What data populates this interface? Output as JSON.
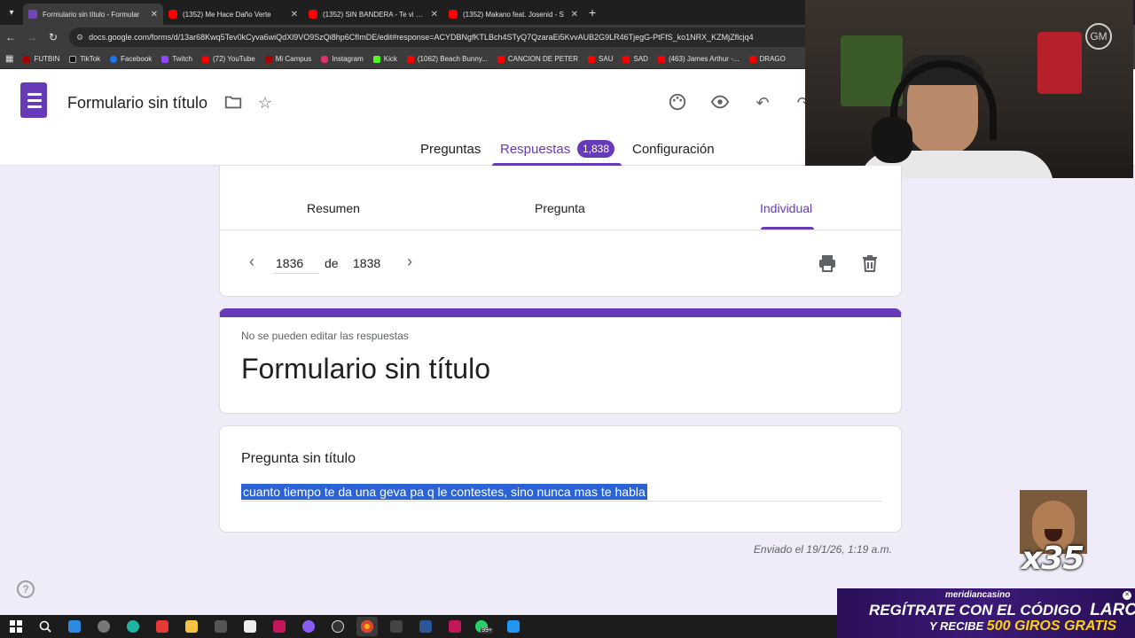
{
  "browser": {
    "tabs": [
      {
        "title": "Formulario sin título - Formular",
        "type": "forms",
        "active": true
      },
      {
        "title": "(1352) Me Hace Daño Verte",
        "type": "yt",
        "active": false
      },
      {
        "title": "(1352) SIN BANDERA - Te vi ven",
        "type": "yt",
        "active": false
      },
      {
        "title": "(1352) Makano feat. Josenid - S",
        "type": "yt",
        "active": false
      }
    ],
    "url": "docs.google.com/forms/d/13ar68Kwq5Tev0kCyva6wiQdXl9VO9SzQi8hp6CfImDE/edit#response=ACYDBNgfKTLBch4STyQ7QzaraEi5KvvAUB2G9LR46TjegG-PtFfS_ko1NRX_KZMjZflcjq4",
    "bookmarks": [
      {
        "label": "FUTBIN",
        "icon": "mc"
      },
      {
        "label": "TikTok",
        "icon": "tk"
      },
      {
        "label": "Facebook",
        "icon": "fb"
      },
      {
        "label": "Twitch",
        "icon": "tw"
      },
      {
        "label": "(72) YouTube",
        "icon": "yt"
      },
      {
        "label": "Mi Campus",
        "icon": "mc"
      },
      {
        "label": "Instagram",
        "icon": "ig"
      },
      {
        "label": "Kick",
        "icon": "kk"
      },
      {
        "label": "(1062) Beach Bunny...",
        "icon": "yt"
      },
      {
        "label": "CANCION DE PETER",
        "icon": "yt"
      },
      {
        "label": "SAU",
        "icon": "yt"
      },
      {
        "label": "SAD",
        "icon": "yt"
      },
      {
        "label": "(463) James Arthur -...",
        "icon": "yt"
      },
      {
        "label": "DRAGO",
        "icon": "yt"
      }
    ]
  },
  "header": {
    "form_title": "Formulario sin título",
    "tabs": {
      "questions": "Preguntas",
      "responses": "Respuestas",
      "responses_count": "1,838",
      "settings": "Configuración"
    }
  },
  "responses": {
    "subtabs": {
      "summary": "Resumen",
      "question": "Pregunta",
      "individual": "Individual"
    },
    "pager": {
      "current": "1836",
      "of_label": "de",
      "total": "1838"
    }
  },
  "form_card": {
    "no_edit_notice": "No se pueden editar las respuestas",
    "title": "Formulario sin título"
  },
  "question_card": {
    "question": "Pregunta sin título",
    "answer": "cuanto tiempo te da una geva pa q le contestes, sino nunca mas te habla"
  },
  "submitted": "Enviado el 19/1/26, 1:19 a.m.",
  "overlays": {
    "webcam_logo": "GM",
    "meme_count": "x35",
    "banner": {
      "brand": "meridiancasino",
      "line1": "REGÍTRATE CON EL CÓDIGO",
      "code": "LARCPLAY",
      "line2_prefix": "Y RECIBE",
      "line2_highlight": "500 GIROS GRATIS"
    }
  },
  "taskbar": {
    "badge": "99+"
  },
  "colors": {
    "accent": "#673ab7",
    "page_bg": "#f0ebf8",
    "selection": "#2b63d6"
  }
}
